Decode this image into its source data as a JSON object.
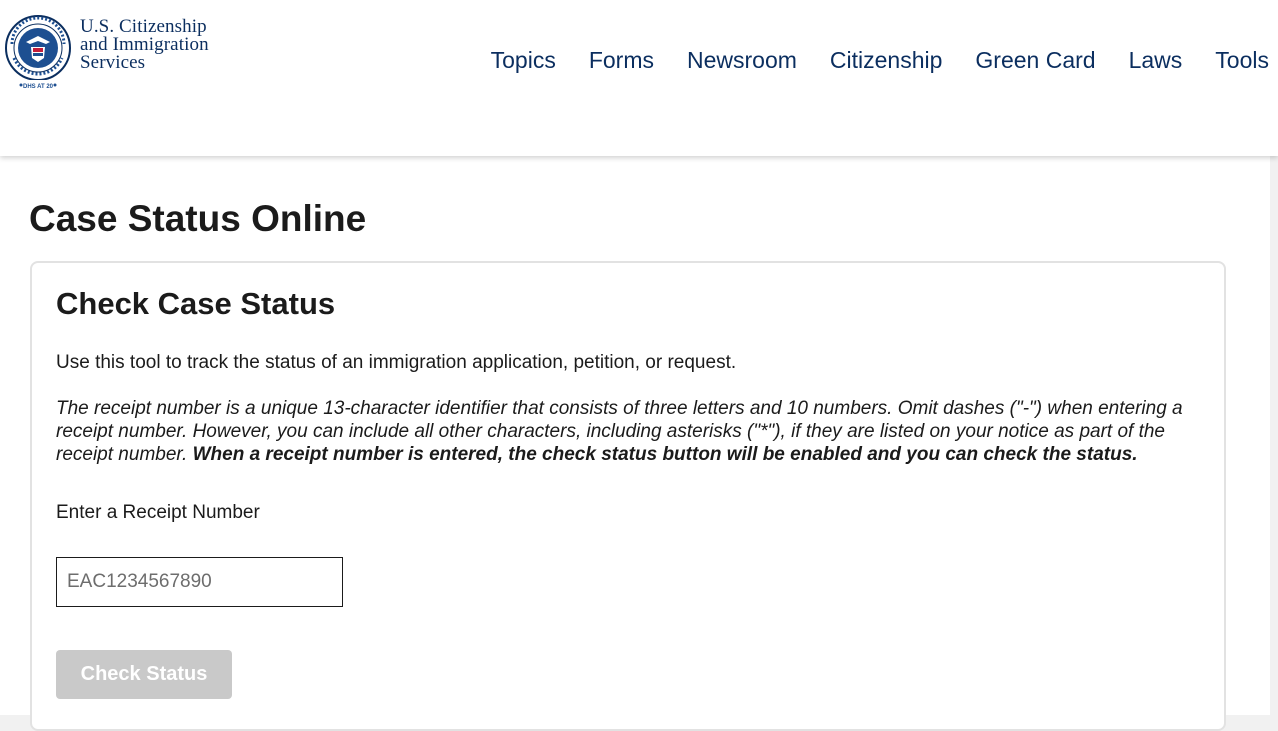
{
  "header": {
    "agency_name_lines": [
      "U.S. Citizenship",
      "and Immigration",
      "Services"
    ],
    "seal": {
      "ring_text": "U.S. DEPARTMENT OF HOMELAND SECURITY",
      "anniversary_text": "DHS AT 20"
    },
    "nav": [
      {
        "label": "Topics"
      },
      {
        "label": "Forms"
      },
      {
        "label": "Newsroom"
      },
      {
        "label": "Citizenship"
      },
      {
        "label": "Green Card"
      },
      {
        "label": "Laws"
      },
      {
        "label": "Tools"
      }
    ]
  },
  "main": {
    "page_title": "Case Status Online",
    "card": {
      "title": "Check Case Status",
      "intro": "Use this tool to track the status of an immigration application, petition, or request.",
      "note_italic": "The receipt number is a unique 13-character identifier that consists of three letters and 10 numbers. Omit dashes (\"-\") when entering a receipt number. However, you can include all other characters, including asterisks (\"*\"), if they are listed on your notice as part of the receipt number. ",
      "note_bold": "When a receipt number is entered, the check status button will be enabled and you can check the status.",
      "field_label": "Enter a Receipt Number",
      "input_value": "",
      "input_placeholder": "EAC1234567890",
      "button_label": "Check Status",
      "button_enabled": false
    }
  },
  "colors": {
    "brand_navy": "#0b2e5f",
    "text": "#1b1b1b",
    "button_disabled": "#c9c9c9",
    "card_border": "#e2e2e2",
    "page_background": "#f1f1f1"
  }
}
